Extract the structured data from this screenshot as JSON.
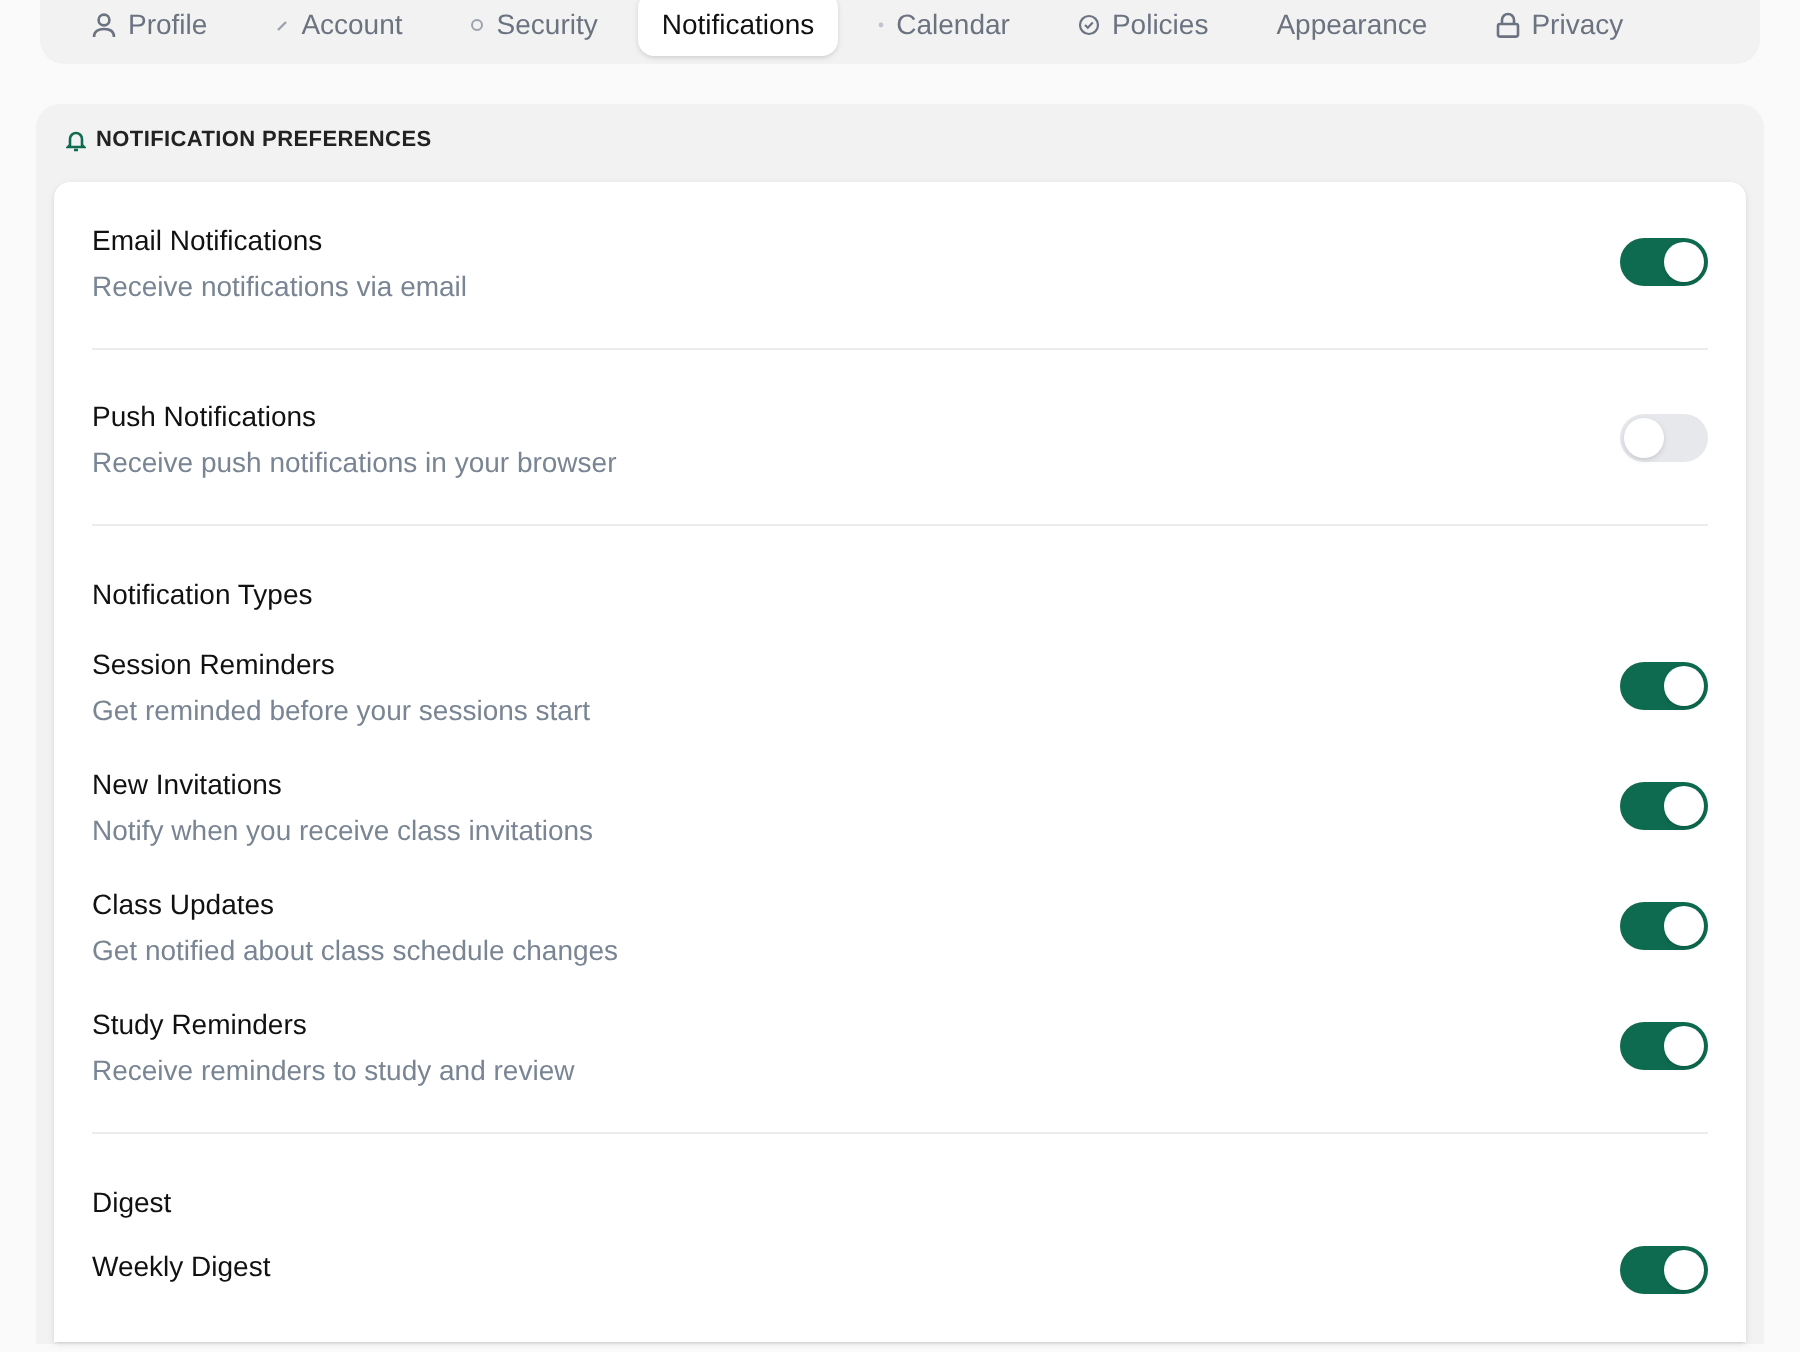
{
  "tabs": [
    {
      "label": "Profile",
      "selected": false
    },
    {
      "label": "Account",
      "selected": false
    },
    {
      "label": "Security",
      "selected": false
    },
    {
      "label": "Notifications",
      "selected": true
    },
    {
      "label": "Calendar",
      "selected": false
    },
    {
      "label": "Policies",
      "selected": false
    },
    {
      "label": "Appearance",
      "selected": false
    },
    {
      "label": "Privacy",
      "selected": false
    }
  ],
  "panel": {
    "title": "NOTIFICATION PREFERENCES",
    "sections": [
      {
        "items": [
          {
            "title": "Email Notifications",
            "description": "Receive notifications via email",
            "on": true
          }
        ]
      },
      {
        "items": [
          {
            "title": "Push Notifications",
            "description": "Receive push notifications in your browser",
            "on": false
          }
        ]
      },
      {
        "heading": "Notification Types",
        "items": [
          {
            "title": "Session Reminders",
            "description": "Get reminded before your sessions start",
            "on": true
          },
          {
            "title": "New Invitations",
            "description": "Notify when you receive class invitations",
            "on": true
          },
          {
            "title": "Class Updates",
            "description": "Get notified about class schedule changes",
            "on": true
          },
          {
            "title": "Study Reminders",
            "description": "Receive reminders to study and review",
            "on": true
          }
        ]
      },
      {
        "heading": "Digest",
        "items": [
          {
            "title": "Weekly Digest",
            "on": true
          }
        ]
      }
    ]
  }
}
